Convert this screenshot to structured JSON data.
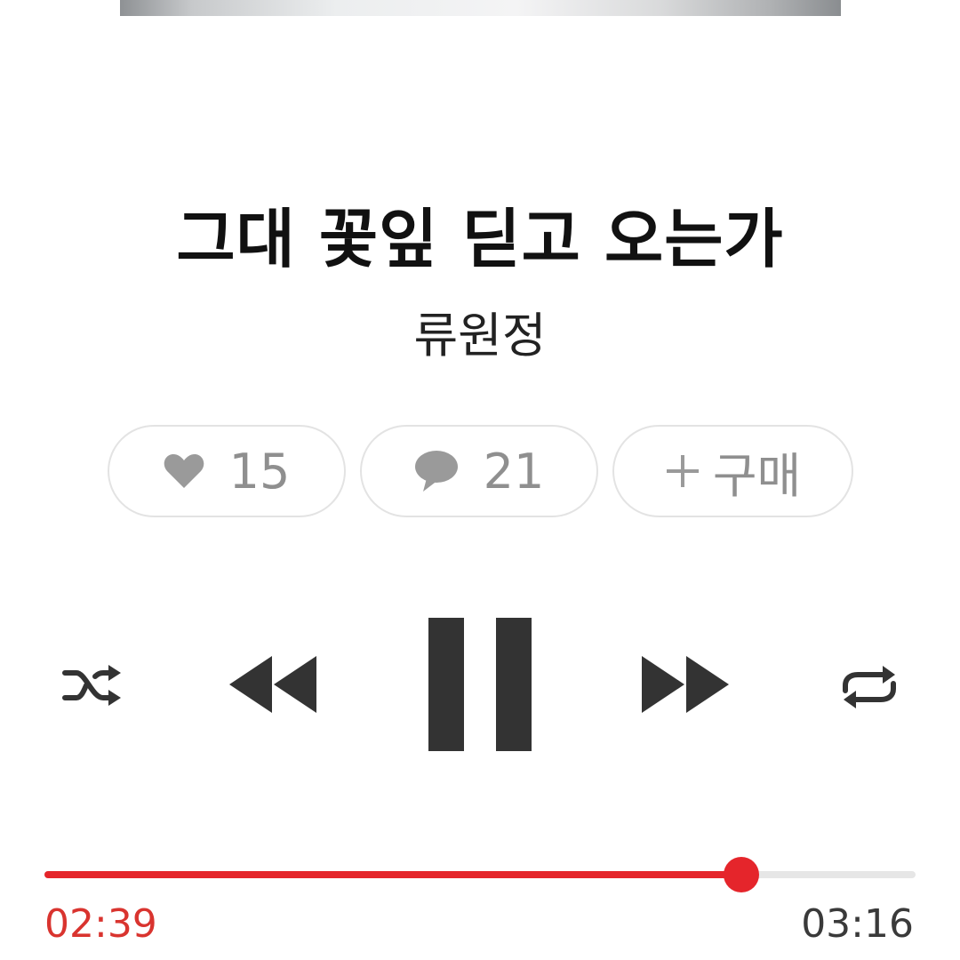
{
  "track": {
    "title": "그대 꽃잎 딛고 오는가",
    "artist": "류원정"
  },
  "actions": {
    "like_count": "15",
    "comment_count": "21",
    "buy_label": "구매"
  },
  "icons": {
    "like": "heart-icon",
    "comment": "speech-bubble-icon",
    "buy": "plus-icon",
    "shuffle": "shuffle-icon",
    "previous": "rewind-icon",
    "play_state": "pause-icon",
    "next": "fast-forward-icon",
    "repeat": "repeat-icon"
  },
  "player": {
    "state": "playing",
    "elapsed": "02:39",
    "total": "03:16",
    "progress_fraction": 0.8
  },
  "colors": {
    "accent": "#e5252b",
    "elapsed_text": "#d9342f",
    "controls": "#333333",
    "pill_text": "#8f8f8f"
  }
}
